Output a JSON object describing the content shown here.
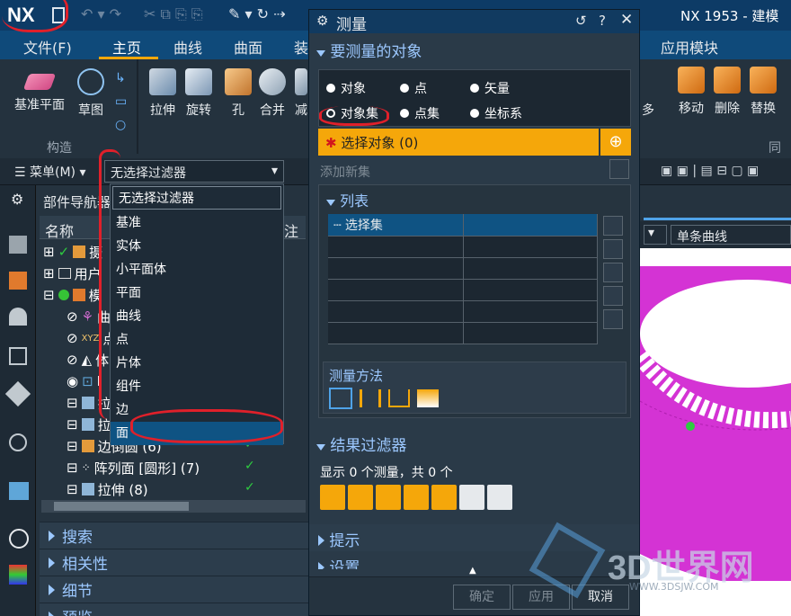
{
  "app": {
    "logo": "NX",
    "title": "NX 1953 - 建模"
  },
  "menubar": {
    "file": "文件(F)",
    "tabs": [
      "主页",
      "曲线",
      "曲面",
      "装"
    ],
    "apps": "应用模块"
  },
  "ribbon": {
    "left": [
      "基准平面",
      "草图"
    ],
    "group_label": "构造",
    "features": [
      "拉伸",
      "旋转",
      "孔",
      "合并",
      "减"
    ],
    "right": [
      "移动",
      "删除",
      "替换"
    ],
    "right_partial": "多",
    "sync_label": "同步"
  },
  "toolbar2": {
    "menu": "菜单(M)",
    "filter": "无选择过滤器",
    "curve_rule": "单条曲线"
  },
  "filter_dropdown": {
    "items": [
      "无选择过滤器",
      "基准",
      "实体",
      "小平面体",
      "平面",
      "曲线",
      "点",
      "片体",
      "组件",
      "边",
      "面"
    ],
    "selected": "面"
  },
  "nav": {
    "title": "部件导航器",
    "col_name": "名称",
    "col_note": "注",
    "rows": [
      "摄",
      "用户",
      "模",
      "",
      "",
      "",
      "",
      "",
      "",
      "边倒圆 (6)",
      "阵列面 [圆形] (7)",
      "拉伸 (8)"
    ],
    "partials": [
      "摄",
      "用户",
      "模",
      "曲",
      "点",
      "体",
      "I",
      "拉",
      "拉"
    ],
    "check": "✓",
    "sections": [
      "搜索",
      "相关性",
      "细节",
      "预览"
    ]
  },
  "dialog": {
    "title": "测量",
    "sec_objects": "要测量的对象",
    "radios": [
      {
        "label": "对象",
        "checked": false
      },
      {
        "label": "点",
        "checked": false
      },
      {
        "label": "矢量",
        "checked": false
      },
      {
        "label": "对象集",
        "checked": true
      },
      {
        "label": "点集",
        "checked": false
      },
      {
        "label": "坐标系",
        "checked": false
      }
    ],
    "select_objects": "选择对象 (0)",
    "add_new_set": "添加新集",
    "list_label": "列表",
    "list_first": "选择集",
    "method_label": "测量方法",
    "result_filter": "结果过滤器",
    "result_text": "显示 0 个测量，共 0 个",
    "hint": "提示",
    "settings": "设置",
    "ok": "确定",
    "apply": "应用",
    "cancel": "取消"
  },
  "watermark": "3D世界网",
  "watermark_url": "WWW.3DSJW.COM",
  "colors": {
    "accent": "#f5a70a",
    "selection": "#0f5383",
    "model": "#d433d4"
  }
}
